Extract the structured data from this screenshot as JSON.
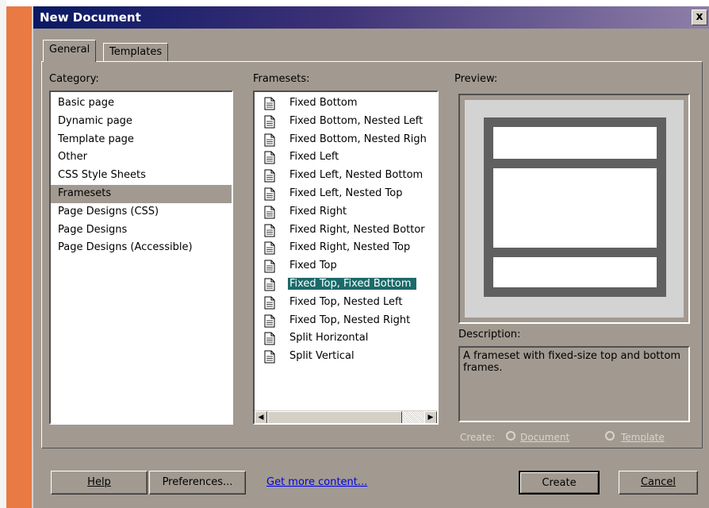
{
  "window": {
    "title": "New Document",
    "close_glyph": "x"
  },
  "tabs": [
    {
      "label": "General",
      "selected": true
    },
    {
      "label": "Templates",
      "selected": false
    }
  ],
  "category": {
    "label": "Category:",
    "items": [
      "Basic page",
      "Dynamic page",
      "Template page",
      "Other",
      "CSS Style Sheets",
      "Framesets",
      "Page Designs (CSS)",
      "Page Designs",
      "Page Designs (Accessible)"
    ],
    "selected": "Framesets"
  },
  "framesets": {
    "label": "Framesets:",
    "items": [
      "Fixed Bottom",
      "Fixed Bottom, Nested Left",
      "Fixed Bottom, Nested Righ",
      "Fixed Left",
      "Fixed Left, Nested Bottom",
      "Fixed Left, Nested Top",
      "Fixed Right",
      "Fixed Right, Nested Bottor",
      "Fixed Right, Nested Top",
      "Fixed Top",
      "Fixed Top, Fixed Bottom",
      "Fixed Top, Nested Left",
      "Fixed Top, Nested Right",
      "Split Horizontal",
      "Split Vertical"
    ],
    "selected": "Fixed Top, Fixed Bottom",
    "item_icon": "document-icon"
  },
  "preview": {
    "label": "Preview:"
  },
  "description": {
    "label": "Description:",
    "text": "A frameset with fixed-size top and bottom frames."
  },
  "create": {
    "label": "Create:",
    "option_document": "Document",
    "option_template": "Template",
    "enabled": false
  },
  "buttons": {
    "help": "Help",
    "preferences": "Preferences...",
    "create": "Create",
    "cancel": "Cancel"
  },
  "link": {
    "more_content": "Get more content..."
  },
  "colors": {
    "dialog_bg": "#a29a91",
    "selection": "#1b6a6a",
    "accent_orange": "#e97a43"
  }
}
